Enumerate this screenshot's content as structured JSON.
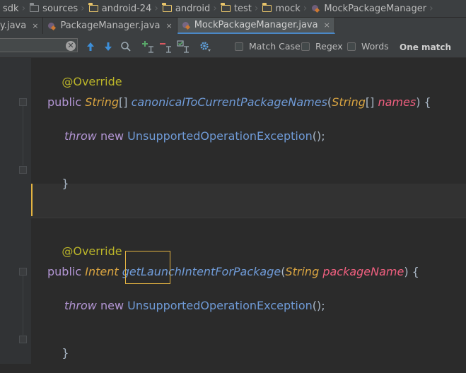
{
  "breadcrumb": {
    "items": [
      {
        "label": "sdk",
        "icon": "none"
      },
      {
        "label": "sources",
        "icon": "folder-grey"
      },
      {
        "label": "android-24",
        "icon": "folder"
      },
      {
        "label": "android",
        "icon": "folder"
      },
      {
        "label": "test",
        "icon": "folder"
      },
      {
        "label": "mock",
        "icon": "folder"
      },
      {
        "label": "MockPackageManager",
        "icon": "class"
      }
    ]
  },
  "tabs": [
    {
      "label": "y.java",
      "close": "×",
      "active": false
    },
    {
      "label": "PackageManager.java",
      "close": "×",
      "active": false
    },
    {
      "label": "MockPackageManager.java",
      "close": "×",
      "active": true
    }
  ],
  "search": {
    "value": "",
    "clear_glyph": "✕",
    "options": {
      "match_case": "Match Case",
      "regex": "Regex",
      "words": "Words"
    },
    "status": "One match"
  },
  "code": {
    "annotation": "@Override",
    "line1": {
      "kw": "public",
      "ret": "String",
      "brackets": "[]",
      "name": "canonicalToCurrentPackageNames",
      "open": "(",
      "ptype": "String",
      "pbrackets": "[]",
      "pname": "names",
      "close": ") {"
    },
    "throw": {
      "kw1": "throw",
      "kw2": "new",
      "exc": "UnsupportedOperationException",
      "end": "();"
    },
    "brace": "}",
    "line2": {
      "kw": "public",
      "ret": "Intent",
      "name": "getLaunchIntentForPackage",
      "open": "(",
      "ptype": "String",
      "pname": "packageName",
      "close": ") {"
    }
  },
  "colors": {
    "background": "#2b2b2b",
    "keyword": "#b295d3",
    "annotation": "#bbb529",
    "type": "#d9a441",
    "method": "#6f9ad6",
    "param": "#ef5f7f",
    "search_highlight": "#e3b341"
  }
}
